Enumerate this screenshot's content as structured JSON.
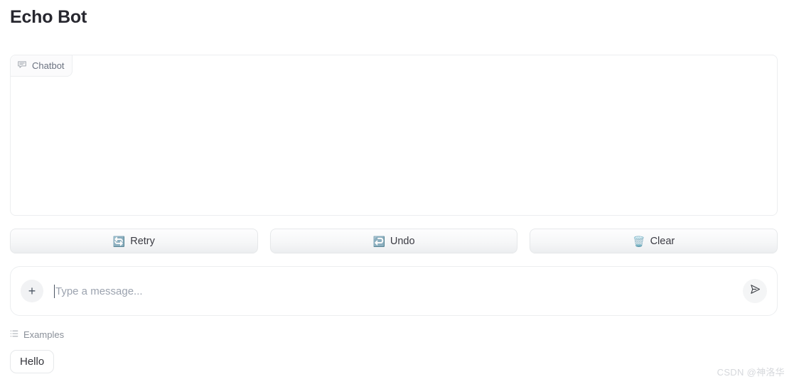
{
  "page": {
    "title": "Echo Bot"
  },
  "chatbot": {
    "label": "Chatbot",
    "label_icon": "chat-bubble-icon",
    "messages": []
  },
  "actions": [
    {
      "label": "Retry",
      "icon": "refresh-emoji-icon",
      "glyph": "🔄"
    },
    {
      "label": "Undo",
      "icon": "undo-arrow-emoji-icon",
      "glyph": "↩️"
    },
    {
      "label": "Clear",
      "icon": "wastebasket-emoji-icon",
      "glyph": "🗑️"
    }
  ],
  "input": {
    "placeholder": "Type a message...",
    "value": "",
    "plus_label": "+",
    "plus_icon": "plus-icon",
    "send_icon": "send-paper-plane-icon"
  },
  "examples": {
    "header": "Examples",
    "header_icon": "list-icon",
    "items": [
      {
        "label": "Hello"
      }
    ]
  },
  "watermark": {
    "text": "CSDN @神洛华"
  },
  "colors": {
    "background": "#ffffff",
    "title": "#27272f",
    "border": "#eceef0",
    "muted_text": "#9ca3af",
    "button_face": "#f6f7f8",
    "watermark": "#d6d8dc"
  }
}
